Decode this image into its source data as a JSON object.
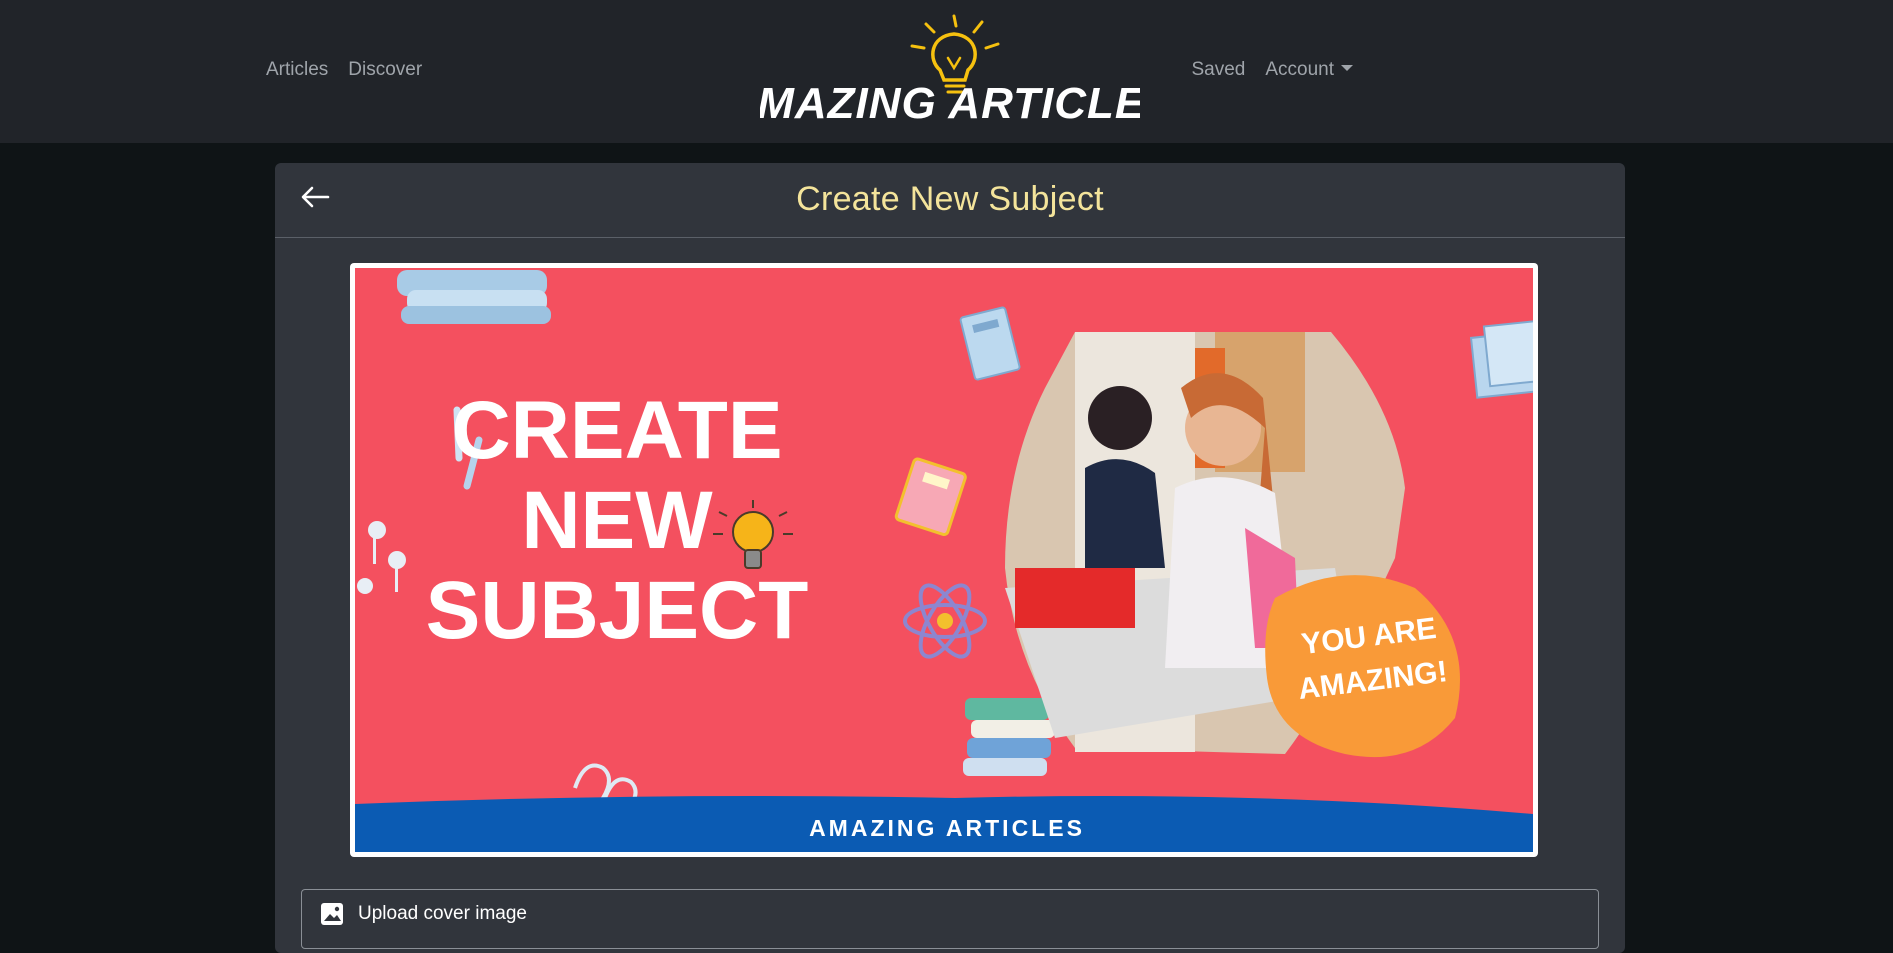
{
  "nav": {
    "left_links": [
      "Articles",
      "Discover"
    ],
    "right_links": {
      "saved": "Saved",
      "account": "Account"
    },
    "brand_text": "AMAZING ARTICLES"
  },
  "page": {
    "title": "Create New Subject",
    "back_icon": "arrow-left-icon"
  },
  "banner": {
    "headline_lines": [
      "CREATE",
      "NEW",
      "SUBJECT"
    ],
    "badge_lines": [
      "YOU ARE",
      "AMAZING!"
    ],
    "footer_text": "AMAZING ARTICLES",
    "colors": {
      "background": "#f4505f",
      "footer": "#0b5bb3",
      "badge": "#f99a38"
    }
  },
  "upload": {
    "label": "Upload cover image",
    "icon": "image-icon"
  },
  "colors": {
    "navbar": "#212429",
    "page_bg": "#0f1416",
    "card": "#31353c",
    "title": "#f4e49b",
    "brand_bulb": "#f6c10f"
  }
}
